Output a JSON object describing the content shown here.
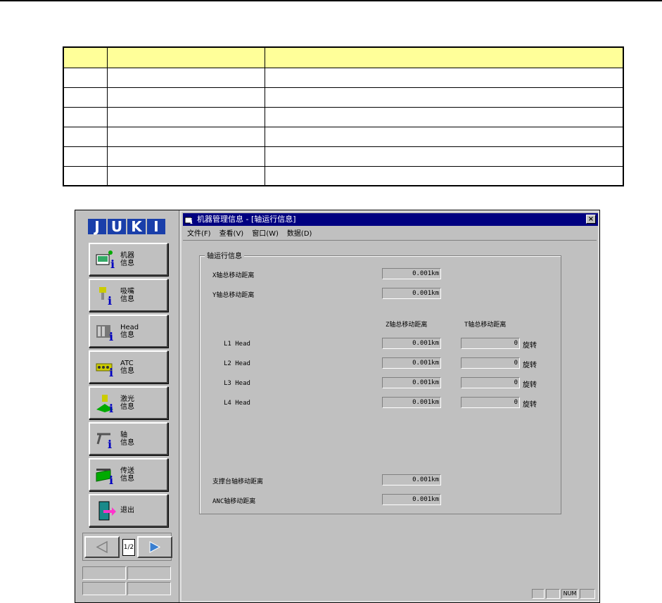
{
  "window": {
    "title": "机器管理信息 - [轴运行信息]",
    "close_label": "×"
  },
  "menu": [
    {
      "label": "文件(F)"
    },
    {
      "label": "查看(V)"
    },
    {
      "label": "窗口(W)"
    },
    {
      "label": "数据(D)"
    }
  ],
  "logo": {
    "letters": [
      "J",
      "U",
      "K",
      "I"
    ],
    "color": "#1a3faa"
  },
  "nav": [
    {
      "label": "机器\n信息",
      "icon": "machine-info-icon"
    },
    {
      "label": "吸嘴\n信息",
      "icon": "nozzle-info-icon"
    },
    {
      "label": "Head\n信息",
      "icon": "head-info-icon"
    },
    {
      "label": "ATC\n信息",
      "icon": "atc-info-icon"
    },
    {
      "label": "激光\n信息",
      "icon": "laser-info-icon"
    },
    {
      "label": "轴\n信息",
      "icon": "axis-info-icon"
    },
    {
      "label": "传送\n信息",
      "icon": "conveyor-info-icon"
    },
    {
      "label": "退出",
      "icon": "exit-icon"
    }
  ],
  "pager": {
    "page": "1/2"
  },
  "panel": {
    "group_title": "轴运行信息",
    "x_label": "X轴总移动距离",
    "x_value": "0.001km",
    "y_label": "Y轴总移动距离",
    "y_value": "0.001km",
    "z_header": "Z轴总移动距离",
    "t_header": "T轴总移动距离",
    "heads": [
      {
        "name": "L1 Head",
        "z": "0.001km",
        "t": "0",
        "unit": "旋转"
      },
      {
        "name": "L2 Head",
        "z": "0.001km",
        "t": "0",
        "unit": "旋转"
      },
      {
        "name": "L3 Head",
        "z": "0.001km",
        "t": "0",
        "unit": "旋转"
      },
      {
        "name": "L4 Head",
        "z": "0.001km",
        "t": "0",
        "unit": "旋转"
      }
    ],
    "support_label": "支撑台轴移动距离",
    "support_value": "0.001km",
    "anc_label": "ANC轴移动距离",
    "anc_value": "0.001km"
  },
  "status": {
    "num": "NUM"
  },
  "colors": {
    "titlebar": "#000080",
    "header_fill": "#ffff99",
    "face": "#c0c0c0"
  }
}
